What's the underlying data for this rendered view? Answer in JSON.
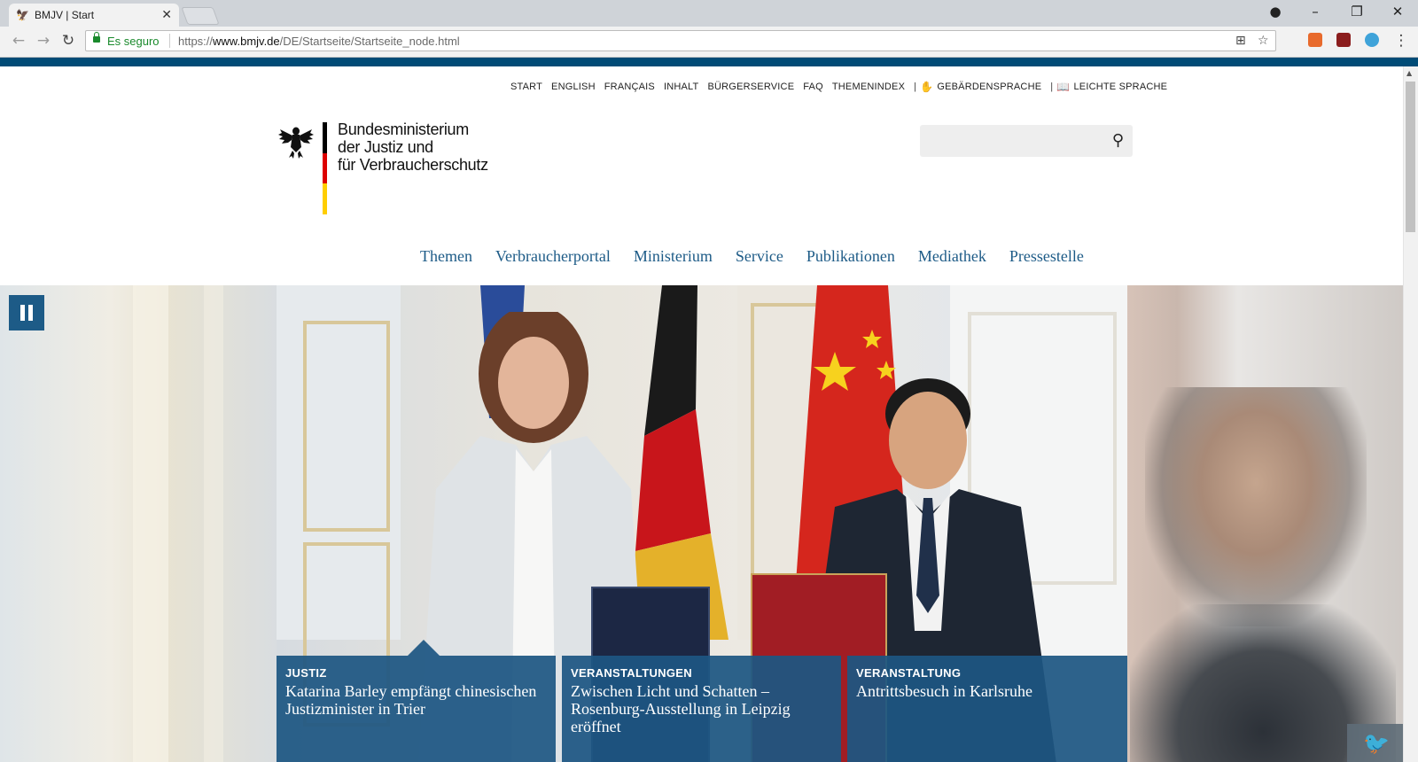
{
  "browser": {
    "tab_title": "BMJV | Start",
    "tab_close": "✕",
    "secure_label": "Es seguro",
    "url_scheme": "https://",
    "url_host": "www.bmjv.de",
    "url_path": "/DE/Startseite/Startseite_node.html"
  },
  "meta_nav": {
    "items": [
      "START",
      "ENGLISH",
      "FRANÇAIS",
      "INHALT",
      "BÜRGERSERVICE",
      "FAQ",
      "THEMENINDEX"
    ],
    "sign_language": "GEBÄRDENSPRACHE",
    "easy_language": "LEICHTE SPRACHE"
  },
  "logo": {
    "line1": "Bundesministerium",
    "line2": "der Justiz und",
    "line3": "für Verbraucherschutz",
    "flag_colors": [
      "#000000",
      "#dd0000",
      "#ffce00"
    ]
  },
  "search": {
    "placeholder": ""
  },
  "main_nav": {
    "items": [
      "Themen",
      "Verbraucherportal",
      "Ministerium",
      "Service",
      "Publikationen",
      "Mediathek",
      "Pressestelle"
    ]
  },
  "hero": {
    "teasers": [
      {
        "category": "JUSTIZ",
        "title": "Katarina Barley empfängt chinesischen Justizminister in Trier"
      },
      {
        "category": "VERANSTALTUNGEN",
        "title": "Zwischen Licht und Schatten – Rosenburg-Ausstellung in Leipzig eröffnet"
      },
      {
        "category": "VERANSTALTUNG",
        "title": "Antrittsbesuch in Karlsruhe"
      }
    ]
  },
  "colors": {
    "brand_blue": "#004b76",
    "nav_link": "#1d5b87",
    "teaser_bg": "#1d5682"
  }
}
